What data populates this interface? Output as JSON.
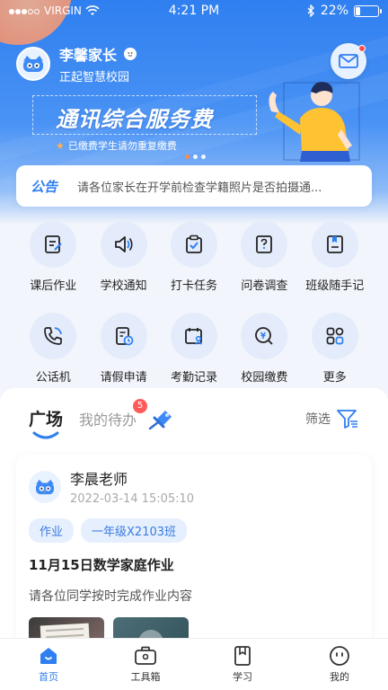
{
  "status_bar": {
    "carrier": "VIRGIN",
    "time": "4:21 PM",
    "battery": "22%",
    "battery_level": 0.22
  },
  "user": {
    "name": "李馨家长",
    "school": "正起智慧校园"
  },
  "banner": {
    "title": "通讯综合服务费",
    "subtitle": "已缴费学生请勿重复缴费"
  },
  "notice": {
    "tag": "公告",
    "text": "请各位家长在开学前检查学籍照片是否拍摄通..."
  },
  "menu": [
    {
      "label": "课后作业",
      "icon": "homework-icon"
    },
    {
      "label": "学校通知",
      "icon": "megaphone-icon"
    },
    {
      "label": "打卡任务",
      "icon": "checkin-clipboard-icon"
    },
    {
      "label": "问卷调查",
      "icon": "questionnaire-icon"
    },
    {
      "label": "班级随手记",
      "icon": "class-notes-icon"
    },
    {
      "label": "公话机",
      "icon": "phone-icon"
    },
    {
      "label": "请假申请",
      "icon": "leave-request-icon"
    },
    {
      "label": "考勤记录",
      "icon": "attendance-icon"
    },
    {
      "label": "校园缴费",
      "icon": "payment-icon"
    },
    {
      "label": "更多",
      "icon": "more-grid-icon"
    }
  ],
  "feed": {
    "tab_active": "广场",
    "tab_other": "我的待办",
    "todo_count": "5",
    "filter_label": "筛选"
  },
  "post": {
    "author": "李晨老师",
    "time": "2022-03-14 15:05:10",
    "tags": [
      "作业",
      "一年级X2103班"
    ],
    "title": "11月15日数学家庭作业",
    "content": "请各位同学按时完成作业内容"
  },
  "bottom_nav": [
    {
      "label": "首页",
      "icon": "home-icon",
      "active": true
    },
    {
      "label": "工具箱",
      "icon": "toolbox-icon",
      "active": false
    },
    {
      "label": "学习",
      "icon": "study-book-icon",
      "active": false
    },
    {
      "label": "我的",
      "icon": "profile-icon",
      "active": false
    }
  ],
  "colors": {
    "primary": "#2f7ff0",
    "badge": "#ff5a5a",
    "icon_bg": "#e4ecfb"
  }
}
